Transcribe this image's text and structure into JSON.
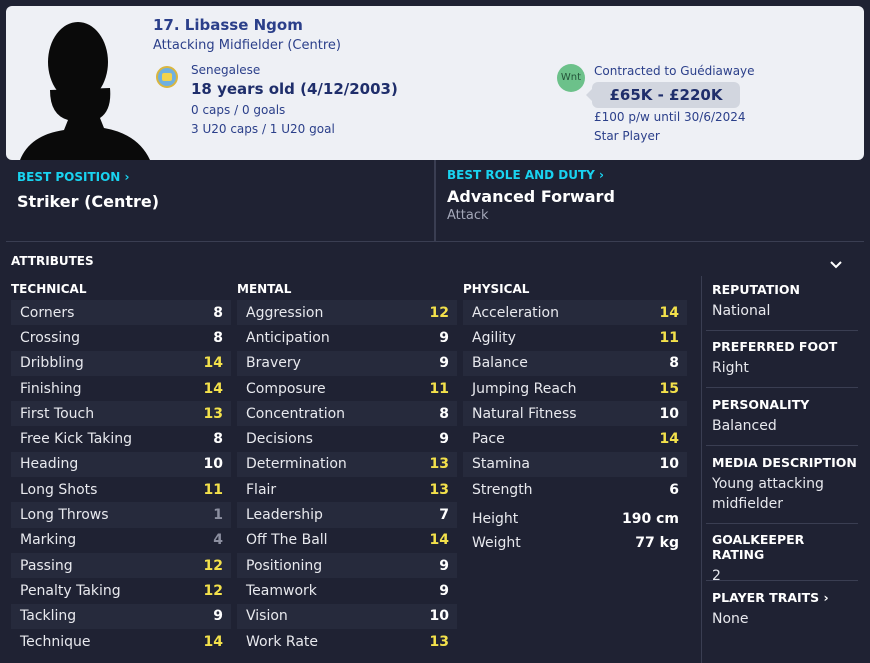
{
  "player": {
    "name": "17. Libasse Ngom",
    "role": "Attacking Midfielder (Centre)",
    "nationality": "Senegalese",
    "age": "18 years old (4/12/2003)",
    "caps": "0 caps / 0 goals",
    "u20": "3 U20 caps / 1 U20 goal"
  },
  "contract": {
    "club_badge": "Wnt",
    "status": "Contracted to Guédiawaye",
    "value": "£65K - £220K",
    "wage": "£100 p/w until 30/6/2024",
    "tag": "Star Player"
  },
  "best_position": {
    "label": "BEST POSITION",
    "value": "Striker (Centre)"
  },
  "best_role": {
    "label": "BEST ROLE AND DUTY",
    "value": "Advanced Forward",
    "duty": "Attack"
  },
  "attributes_title": "ATTRIBUTES",
  "columns": {
    "technical": "TECHNICAL",
    "mental": "MENTAL",
    "physical": "PHYSICAL"
  },
  "technical": [
    {
      "n": "Corners",
      "v": "8"
    },
    {
      "n": "Crossing",
      "v": "8"
    },
    {
      "n": "Dribbling",
      "v": "14"
    },
    {
      "n": "Finishing",
      "v": "14"
    },
    {
      "n": "First Touch",
      "v": "13"
    },
    {
      "n": "Free Kick Taking",
      "v": "8"
    },
    {
      "n": "Heading",
      "v": "10"
    },
    {
      "n": "Long Shots",
      "v": "11"
    },
    {
      "n": "Long Throws",
      "v": "1"
    },
    {
      "n": "Marking",
      "v": "4"
    },
    {
      "n": "Passing",
      "v": "12"
    },
    {
      "n": "Penalty Taking",
      "v": "12"
    },
    {
      "n": "Tackling",
      "v": "9"
    },
    {
      "n": "Technique",
      "v": "14"
    }
  ],
  "mental": [
    {
      "n": "Aggression",
      "v": "12"
    },
    {
      "n": "Anticipation",
      "v": "9"
    },
    {
      "n": "Bravery",
      "v": "9"
    },
    {
      "n": "Composure",
      "v": "11"
    },
    {
      "n": "Concentration",
      "v": "8"
    },
    {
      "n": "Decisions",
      "v": "9"
    },
    {
      "n": "Determination",
      "v": "13"
    },
    {
      "n": "Flair",
      "v": "13"
    },
    {
      "n": "Leadership",
      "v": "7"
    },
    {
      "n": "Off The Ball",
      "v": "14"
    },
    {
      "n": "Positioning",
      "v": "9"
    },
    {
      "n": "Teamwork",
      "v": "9"
    },
    {
      "n": "Vision",
      "v": "10"
    },
    {
      "n": "Work Rate",
      "v": "13"
    }
  ],
  "physical": [
    {
      "n": "Acceleration",
      "v": "14"
    },
    {
      "n": "Agility",
      "v": "11"
    },
    {
      "n": "Balance",
      "v": "8"
    },
    {
      "n": "Jumping Reach",
      "v": "15"
    },
    {
      "n": "Natural Fitness",
      "v": "10"
    },
    {
      "n": "Pace",
      "v": "14"
    },
    {
      "n": "Stamina",
      "v": "10"
    },
    {
      "n": "Strength",
      "v": "6"
    }
  ],
  "physical_extra": [
    {
      "n": "Height",
      "v": "190 cm"
    },
    {
      "n": "Weight",
      "v": "77 kg"
    }
  ],
  "side": {
    "reputation_h": "REPUTATION",
    "reputation": "National",
    "foot_h": "PREFERRED FOOT",
    "foot": "Right",
    "personality_h": "PERSONALITY",
    "personality": "Balanced",
    "media_h": "MEDIA DESCRIPTION",
    "media": "Young attacking midfielder",
    "gk_h": "GOALKEEPER RATING",
    "gk": "2",
    "traits_h": "PLAYER TRAITS",
    "traits": "None"
  },
  "colors": {
    "accent": "#19d3f0",
    "highlight": "#f3e14b",
    "background": "#1f2233"
  }
}
